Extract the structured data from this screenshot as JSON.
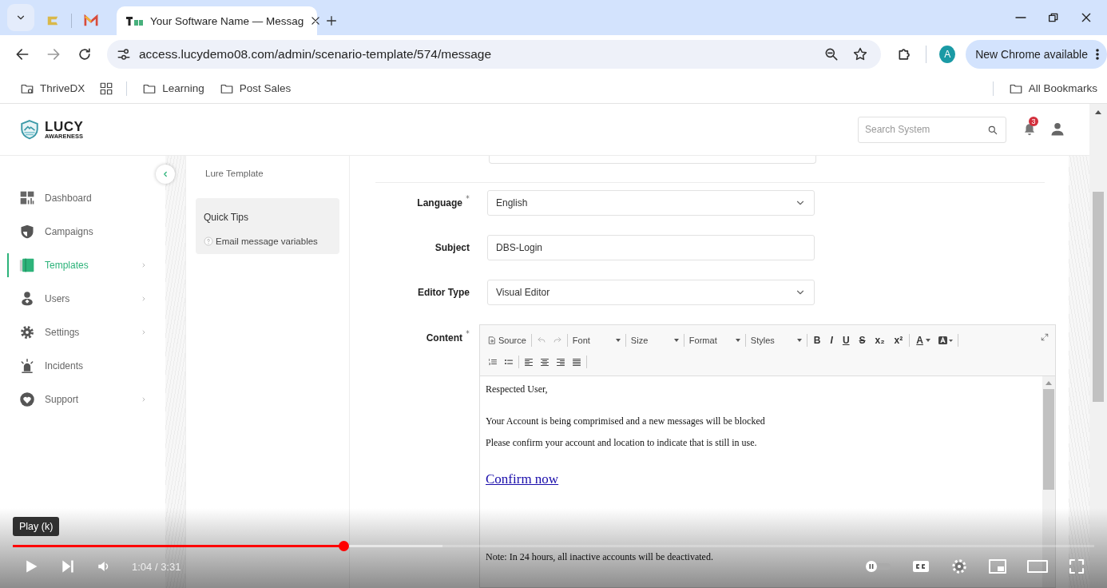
{
  "browser": {
    "tabs": [
      {
        "label": "Your Software Name — Messag",
        "selected": true
      }
    ],
    "url": "access.lucydemo08.com/admin/scenario-template/574/message",
    "profile_initial": "A",
    "update_button": "New Chrome available",
    "bookmarks": [
      {
        "label": "ThriveDX",
        "kind": "managed"
      },
      {
        "kind": "apps"
      },
      {
        "label": "Learning",
        "kind": "folder"
      },
      {
        "label": "Post Sales",
        "kind": "folder"
      }
    ],
    "all_bookmarks": "All Bookmarks"
  },
  "app": {
    "logo": {
      "name": "LUCY",
      "tagline": "AWARENESS"
    },
    "search": {
      "placeholder": "Search System"
    },
    "notifications": "3",
    "nav": [
      {
        "label": "Dashboard",
        "selected": false,
        "submenu": false
      },
      {
        "label": "Campaigns",
        "selected": false,
        "submenu": false
      },
      {
        "label": "Templates",
        "selected": true,
        "submenu": true
      },
      {
        "label": "Users",
        "selected": false,
        "submenu": true
      },
      {
        "label": "Settings",
        "selected": false,
        "submenu": true
      },
      {
        "label": "Incidents",
        "selected": false,
        "submenu": false
      },
      {
        "label": "Support",
        "selected": false,
        "submenu": true
      }
    ],
    "breadcrumb": "Lure Template",
    "quick_tips": {
      "title": "Quick Tips",
      "items": [
        "Email message variables"
      ]
    },
    "form": {
      "fields": [
        {
          "label": "Language",
          "required": true,
          "kind": "select",
          "value": "English"
        },
        {
          "label": "Subject",
          "required": false,
          "kind": "text",
          "value": "DBS-Login"
        },
        {
          "label": "Editor Type",
          "required": false,
          "kind": "select",
          "value": "Visual Editor"
        }
      ],
      "content": {
        "label": "Content",
        "required": true,
        "toolbar": {
          "source": "Source",
          "dropdowns": [
            "Font",
            "Size",
            "Format",
            "Styles"
          ],
          "style_buttons": [
            {
              "label": "B",
              "kind": "bold"
            },
            {
              "label": "I",
              "kind": "italic"
            },
            {
              "label": "U",
              "kind": "underline"
            },
            {
              "label": "S",
              "kind": "strike"
            },
            {
              "label": "x₂",
              "kind": "subscript"
            },
            {
              "label": "x²",
              "kind": "superscript"
            }
          ],
          "text_color": "A"
        },
        "body": [
          {
            "kind": "greeting",
            "text": "Respected User,"
          },
          {
            "kind": "text",
            "text": "Your Account is being comprimised and a new messages will be blocked"
          },
          {
            "kind": "text",
            "text": "Please confirm your account and location to indicate that is still in use."
          },
          {
            "kind": "link",
            "text": "Confirm now"
          },
          {
            "kind": "note",
            "text": "Note: In 24 hours, all inactive accounts will be deactivated."
          }
        ]
      }
    }
  },
  "player": {
    "tooltip": "Play (k)",
    "time": "1:04 / 3:31",
    "progress": {
      "level": 0.306
    }
  }
}
